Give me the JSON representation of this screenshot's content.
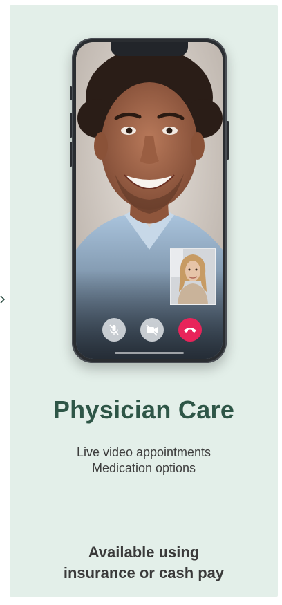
{
  "card": {
    "title": "Physician Care",
    "features": [
      "Live video appointments",
      "Medication options"
    ],
    "availability": [
      "Available using",
      "insurance or cash pay"
    ]
  },
  "phone": {
    "controls": [
      {
        "name": "mic-off-icon"
      },
      {
        "name": "camera-off-icon"
      },
      {
        "name": "end-call-icon"
      }
    ]
  },
  "colors": {
    "card_background": "#e3efe9",
    "title_color": "#2e5647",
    "end_call": "#e8245a"
  }
}
